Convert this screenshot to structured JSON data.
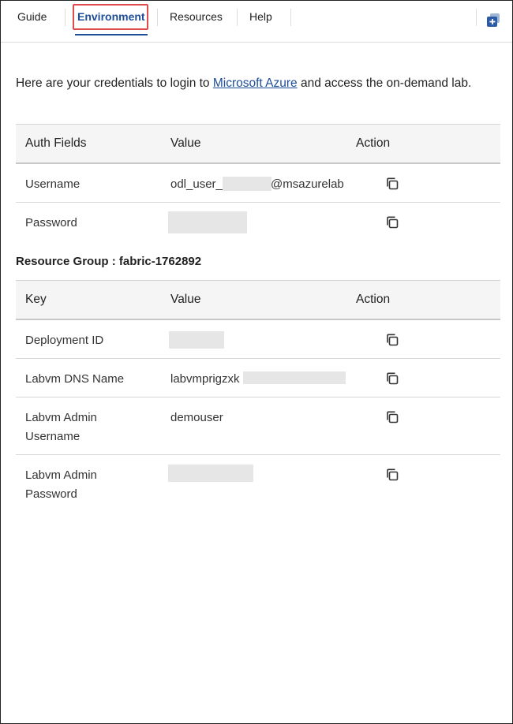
{
  "tabs": [
    {
      "label": "Guide"
    },
    {
      "label": "Environment"
    },
    {
      "label": "Resources"
    },
    {
      "label": "Help"
    }
  ],
  "intro": {
    "before": "Here are your credentials to login to ",
    "link": "Microsoft Azure",
    "after": " and access the on-demand lab."
  },
  "credentials": {
    "headers": {
      "field": "Auth Fields",
      "value": "Value",
      "action": "Action"
    },
    "rows": [
      {
        "field": "Username",
        "value_prefix": "odl_user_",
        "value_suffix": "@msazurelab"
      },
      {
        "field": "Password",
        "value": ""
      }
    ]
  },
  "resource_group": {
    "label": "Resource Group : fabric-1762892"
  },
  "resources": {
    "headers": {
      "key": "Key",
      "value": "Value",
      "action": "Action"
    },
    "rows": [
      {
        "key": "Deployment ID",
        "value": ""
      },
      {
        "key": "Labvm DNS Name",
        "value": "labvmprigzxk"
      },
      {
        "key_line1": "Labvm Admin",
        "key_line2": "Username",
        "value": "demouser"
      },
      {
        "key_line1": "Labvm Admin",
        "key_line2": "Password",
        "value": ""
      }
    ]
  },
  "colors": {
    "accent": "#1e4e9a",
    "highlight": "#e04b4b",
    "header_bg": "#f5f5f5"
  },
  "icons": {
    "copy": "copy-icon",
    "corner": "add-window-icon"
  }
}
